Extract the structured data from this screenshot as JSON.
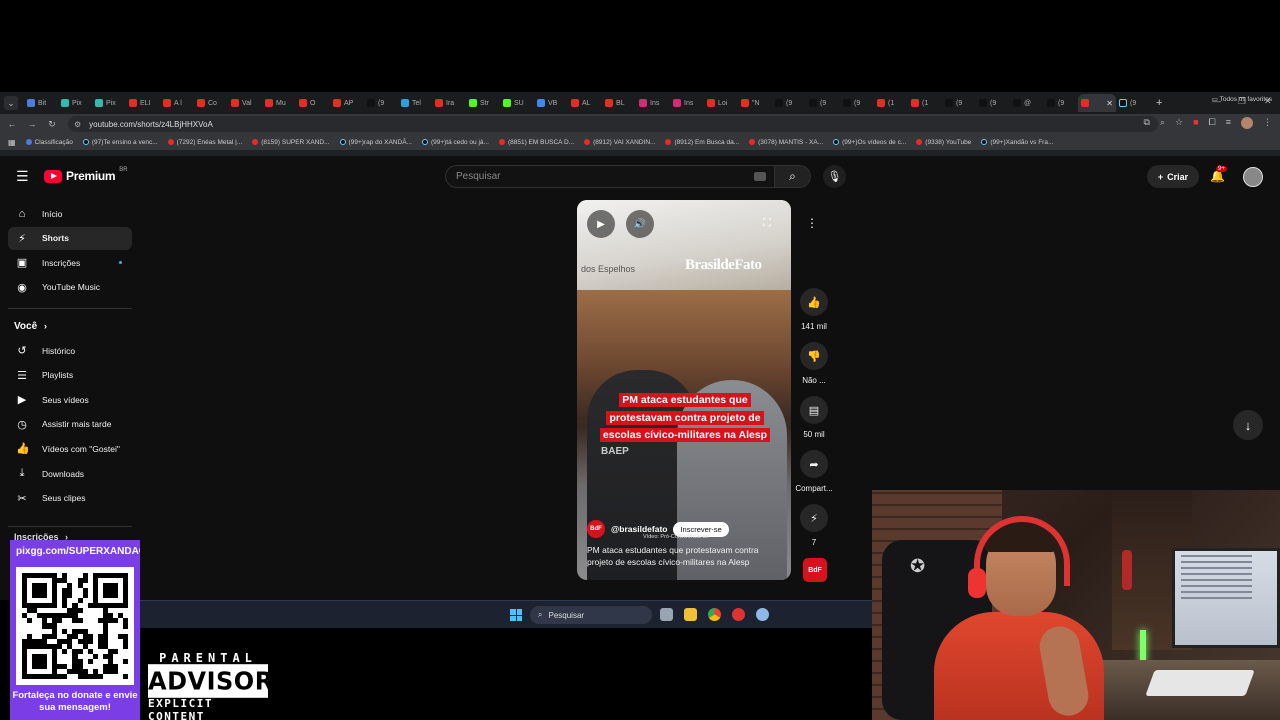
{
  "browser": {
    "tabs": [
      {
        "label": "Bit",
        "color": "#4a7ed8"
      },
      {
        "label": "Pix",
        "color": "#32bcad"
      },
      {
        "label": "Pix",
        "color": "#32bcad"
      },
      {
        "label": "ELI",
        "color": "#e52d27"
      },
      {
        "label": "A l",
        "color": "#e52d27"
      },
      {
        "label": "Co",
        "color": "#e52d27"
      },
      {
        "label": "Val",
        "color": "#e52d27"
      },
      {
        "label": "Mu",
        "color": "#e52d27"
      },
      {
        "label": "O",
        "color": "#e52d27"
      },
      {
        "label": "AP",
        "color": "#e52d27"
      },
      {
        "label": "(9",
        "color": "#111111"
      },
      {
        "label": "Tel",
        "color": "#2aa1da"
      },
      {
        "label": "Ira",
        "color": "#e52d27"
      },
      {
        "label": "Str",
        "color": "#53fc18"
      },
      {
        "label": "SU",
        "color": "#53fc18"
      },
      {
        "label": "VB",
        "color": "#4285f4"
      },
      {
        "label": "AL",
        "color": "#e52d27"
      },
      {
        "label": "BL",
        "color": "#e52d27"
      },
      {
        "label": "Ins",
        "color": "#d62976"
      },
      {
        "label": "Ins",
        "color": "#d62976"
      },
      {
        "label": "Loi",
        "color": "#e52d27"
      },
      {
        "label": "\"N",
        "color": "#e52d27"
      },
      {
        "label": "(9",
        "color": "#111111"
      },
      {
        "label": "(9",
        "color": "#111111"
      },
      {
        "label": "(9",
        "color": "#111111"
      },
      {
        "label": "(1",
        "color": "#e52d27"
      },
      {
        "label": "(1",
        "color": "#e52d27"
      },
      {
        "label": "(9",
        "color": "#111111"
      },
      {
        "label": "(9",
        "color": "#111111"
      },
      {
        "label": "@",
        "color": "#111111"
      },
      {
        "label": "(9",
        "color": "#111111"
      }
    ],
    "active_tab_color": "#e52d27",
    "last_tab": "(9",
    "url": "youtube.com/shorts/z4LBjHHXVoA",
    "bookmarks": [
      {
        "label": "Classificação",
        "type": "bl"
      },
      {
        "label": "(97)Te ensino a venc...",
        "type": "tk"
      },
      {
        "label": "(7292) Enéas Metal |...",
        "type": "yt"
      },
      {
        "label": "(8159) SUPER XAND...",
        "type": "yt"
      },
      {
        "label": "(99+)rap do XANDÃ...",
        "type": "tk"
      },
      {
        "label": "(99+)tá cedo ou já...",
        "type": "tk"
      },
      {
        "label": "(8851) EM BUSCA D...",
        "type": "yt"
      },
      {
        "label": "(8912) VAI XANDIN...",
        "type": "yt"
      },
      {
        "label": "(8912) Em Busca da...",
        "type": "yt"
      },
      {
        "label": "(3078) MANTIS - XA...",
        "type": "yt"
      },
      {
        "label": "(99+)Os vídeos de c...",
        "type": "tk"
      },
      {
        "label": "(9338) YouTube",
        "type": "yt"
      },
      {
        "label": "(99+)Xandão vs Fra...",
        "type": "tk"
      }
    ],
    "all_bookmarks": "Todos os favoritos"
  },
  "youtube": {
    "logo_text": "Premium",
    "logo_region": "BR",
    "search_placeholder": "Pesquisar",
    "create_label": "Criar",
    "notif_count": "9+",
    "sidebar": {
      "main": [
        {
          "label": "Início",
          "icon": "home-icon",
          "glyph": "⌂"
        },
        {
          "label": "Shorts",
          "icon": "shorts-icon",
          "glyph": "⚡"
        },
        {
          "label": "Inscrições",
          "icon": "subscriptions-icon",
          "glyph": "▣"
        },
        {
          "label": "YouTube Music",
          "icon": "music-icon",
          "glyph": "◉"
        }
      ],
      "voce_label": "Você",
      "voce": [
        {
          "label": "Histórico",
          "icon": "history-icon",
          "glyph": "↺"
        },
        {
          "label": "Playlists",
          "icon": "playlists-icon",
          "glyph": "☰"
        },
        {
          "label": "Seus vídeos",
          "icon": "your-videos-icon",
          "glyph": "▶"
        },
        {
          "label": "Assistir mais tarde",
          "icon": "watch-later-icon",
          "glyph": "◷"
        },
        {
          "label": "Vídeos com \"Gostei\"",
          "icon": "liked-icon",
          "glyph": "👍"
        },
        {
          "label": "Downloads",
          "icon": "downloads-icon",
          "glyph": "⤓"
        },
        {
          "label": "Seus clipes",
          "icon": "clips-icon",
          "glyph": "✂"
        }
      ],
      "inscricoes_label": "Inscrições"
    },
    "short": {
      "sign_text": "dos Espelhos",
      "watermark": "BrasildeFato",
      "headline": "PM ataca estudantes que protestavam contra projeto de escolas cívico-militares na Alesp",
      "vest_text": "BAEP",
      "channel": "@brasildefato",
      "channel_logo": "BdF",
      "subscribe_label": "Inscrever-se",
      "tag": "Vídeo: Pró-Convivência-de",
      "caption": "PM ataca estudantes que protestavam contra projeto de escolas cívico-militares na Alesp"
    },
    "actions": {
      "likes": "141 mil",
      "dislike": "Não ...",
      "comments": "50 mil",
      "share": "Compart...",
      "remix": "7"
    }
  },
  "taskbar": {
    "search_label": "Pesquisar"
  },
  "overlay": {
    "qr_url": "pixgg.com/SUPERXANDAO",
    "qr_text": "Fortaleça no donate e envie sua mensagem!",
    "advisory_top": "PARENTAL",
    "advisory_mid": "ADVISORY",
    "advisory_bot": "EXPLICIT CONTENT"
  }
}
